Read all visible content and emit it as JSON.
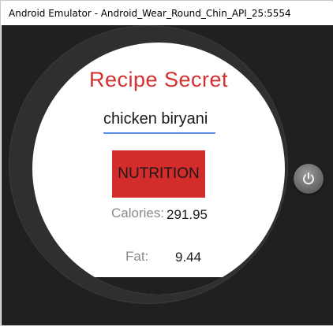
{
  "window": {
    "title": "Android Emulator - Android_Wear_Round_Chin_API_25:5554"
  },
  "app": {
    "title": "Recipe Secret",
    "search": {
      "value": "chicken biryani"
    },
    "nutrition_button_label": "NUTRITION",
    "calories": {
      "label": "Calories:",
      "value": "291.95"
    },
    "fat": {
      "label": "Fat:",
      "value": "9.44"
    }
  },
  "emulator_controls": {
    "power_icon": "power-icon"
  },
  "colors": {
    "accent_red": "#d42b2b",
    "title_red": "#d32f2f",
    "input_underline": "#5b8fe8",
    "bezel": "#2f2f2f",
    "background": "#202020"
  }
}
